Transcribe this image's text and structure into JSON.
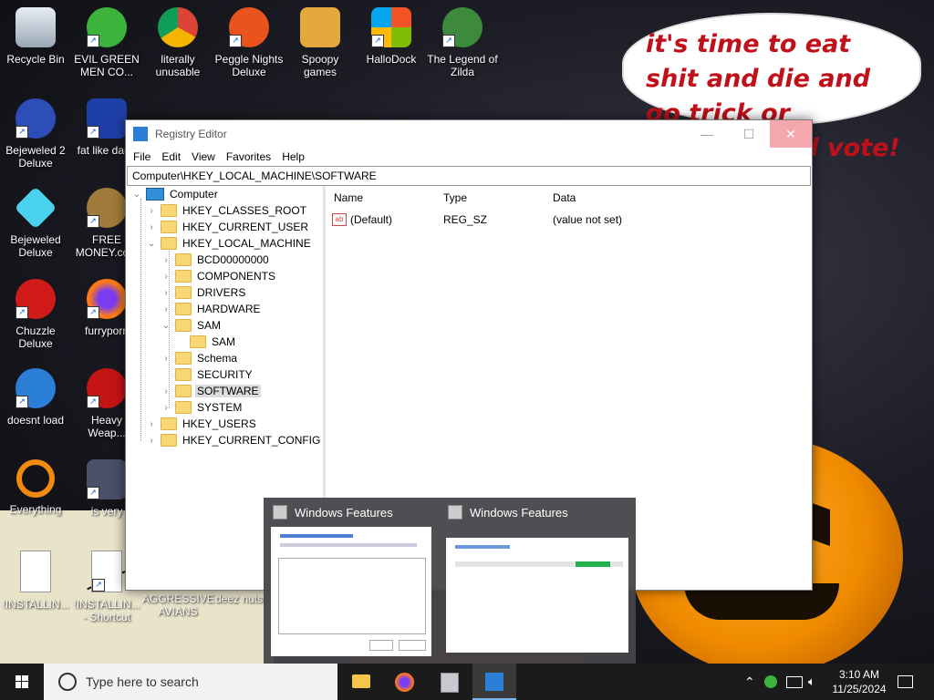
{
  "desktop": {
    "speech_bubble": "it's time to eat shit and die and go trick or treating and vote!",
    "icons": [
      {
        "label": "Recycle Bin"
      },
      {
        "label": "EVIL GREEN MEN CO..."
      },
      {
        "label": "literally unusable"
      },
      {
        "label": "Peggle Nights Deluxe"
      },
      {
        "label": "Spoopy games"
      },
      {
        "label": "HalloDock"
      },
      {
        "label": "The Legend of Zilda"
      },
      {
        "label": "Bejeweled 2 Deluxe"
      },
      {
        "label": "fat like darla"
      },
      {
        "label": "Bejeweled Deluxe"
      },
      {
        "label": "FREE MONEY.com"
      },
      {
        "label": "Chuzzle Deluxe"
      },
      {
        "label": "furryporn"
      },
      {
        "label": "doesnt load"
      },
      {
        "label": "Heavy Weap..."
      },
      {
        "label": "Everything"
      },
      {
        "label": "is very"
      },
      {
        "label": "!INSTALLIN..."
      },
      {
        "label": "!INSTALLIN... - Shortcut"
      },
      {
        "label": "AGGRESSIVE AVIANS"
      },
      {
        "label": "deez nuts"
      }
    ]
  },
  "regedit": {
    "title": "Registry Editor",
    "menu": [
      "File",
      "Edit",
      "View",
      "Favorites",
      "Help"
    ],
    "address": "Computer\\HKEY_LOCAL_MACHINE\\SOFTWARE",
    "tree": {
      "root": "Computer",
      "hkcr": "HKEY_CLASSES_ROOT",
      "hkcu": "HKEY_CURRENT_USER",
      "hklm": "HKEY_LOCAL_MACHINE",
      "bcd": "BCD00000000",
      "components": "COMPONENTS",
      "drivers": "DRIVERS",
      "hardware": "HARDWARE",
      "sam": "SAM",
      "sam_child": "SAM",
      "schema": "Schema",
      "security": "SECURITY",
      "software": "SOFTWARE",
      "system": "SYSTEM",
      "hku": "HKEY_USERS",
      "hkcc": "HKEY_CURRENT_CONFIG"
    },
    "columns": {
      "name": "Name",
      "type": "Type",
      "data": "Data"
    },
    "values": [
      {
        "name": "(Default)",
        "type": "REG_SZ",
        "data": "(value not set)"
      }
    ]
  },
  "thumbnails": [
    {
      "title": "Windows Features"
    },
    {
      "title": "Windows Features"
    }
  ],
  "taskbar": {
    "search_placeholder": "Type here to search",
    "time": "3:10 AM",
    "date": "11/25/2024"
  }
}
